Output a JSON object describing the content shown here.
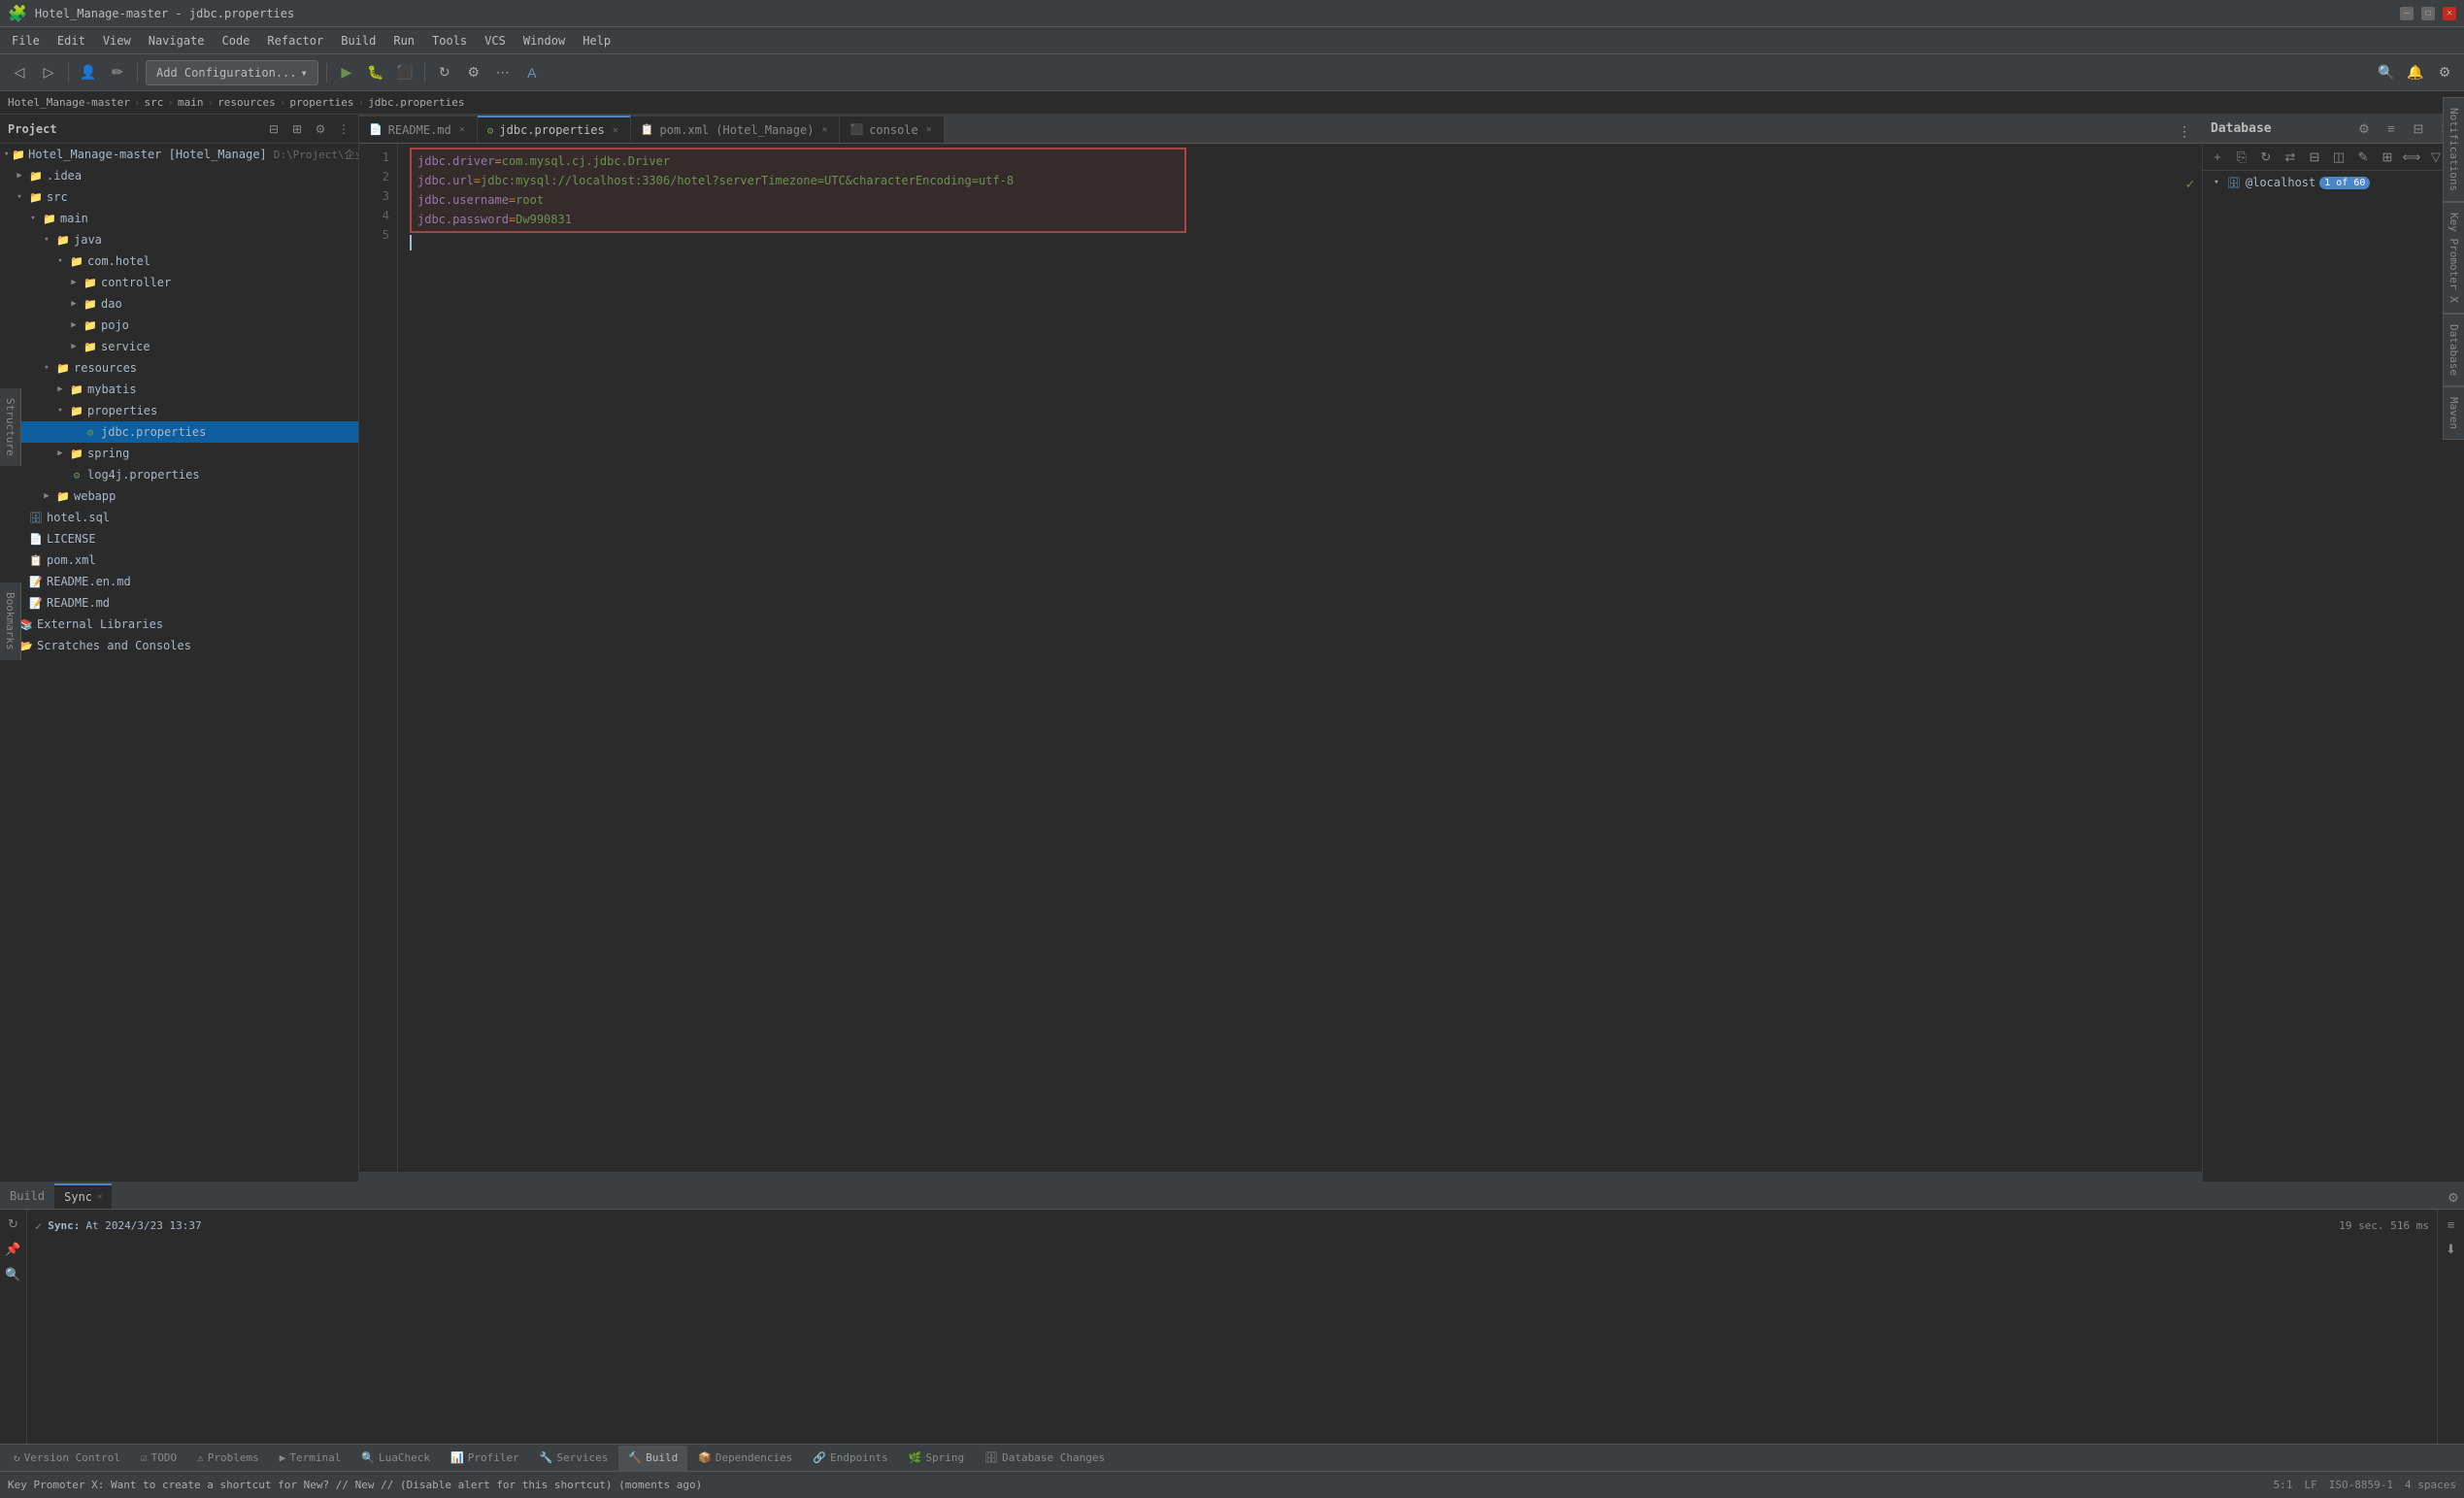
{
  "window": {
    "title": "Hotel_Manage-master - jdbc.properties",
    "controls": [
      "minimize",
      "maximize",
      "close"
    ]
  },
  "menu": {
    "items": [
      "File",
      "Edit",
      "View",
      "Navigate",
      "Code",
      "Refactor",
      "Build",
      "Run",
      "Tools",
      "VCS",
      "Window",
      "Help"
    ]
  },
  "toolbar": {
    "config_label": "Add Configuration...",
    "config_arrow": "▾"
  },
  "breadcrumb": {
    "items": [
      "Hotel_Manage-master",
      "src",
      "main",
      "resources",
      "properties",
      "jdbc.properties"
    ]
  },
  "sidebar": {
    "title": "Project",
    "root": "Hotel_Manage-master [Hotel_Manage]",
    "root_path": "D:\\Project\\企业软著归档\\M",
    "tree": [
      {
        "label": ".idea",
        "indent": 1,
        "type": "folder",
        "expanded": false
      },
      {
        "label": "src",
        "indent": 1,
        "type": "folder",
        "expanded": true
      },
      {
        "label": "main",
        "indent": 2,
        "type": "folder",
        "expanded": true
      },
      {
        "label": "java",
        "indent": 3,
        "type": "folder",
        "expanded": true
      },
      {
        "label": "com.hotel",
        "indent": 4,
        "type": "folder",
        "expanded": true
      },
      {
        "label": "controller",
        "indent": 5,
        "type": "folder",
        "expanded": false
      },
      {
        "label": "dao",
        "indent": 5,
        "type": "folder",
        "expanded": false
      },
      {
        "label": "pojo",
        "indent": 5,
        "type": "folder",
        "expanded": false
      },
      {
        "label": "service",
        "indent": 5,
        "type": "folder",
        "expanded": false
      },
      {
        "label": "resources",
        "indent": 3,
        "type": "folder",
        "expanded": true
      },
      {
        "label": "mybatis",
        "indent": 4,
        "type": "folder",
        "expanded": false
      },
      {
        "label": "properties",
        "indent": 4,
        "type": "folder",
        "expanded": true
      },
      {
        "label": "jdbc.properties",
        "indent": 5,
        "type": "prop",
        "selected": true
      },
      {
        "label": "spring",
        "indent": 4,
        "type": "folder",
        "expanded": false
      },
      {
        "label": "log4j.properties",
        "indent": 4,
        "type": "prop"
      },
      {
        "label": "webapp",
        "indent": 3,
        "type": "folder",
        "expanded": false
      },
      {
        "label": "hotel.sql",
        "indent": 1,
        "type": "sql"
      },
      {
        "label": "LICENSE",
        "indent": 1,
        "type": "file"
      },
      {
        "label": "pom.xml",
        "indent": 1,
        "type": "xml"
      },
      {
        "label": "README.en.md",
        "indent": 1,
        "type": "md"
      },
      {
        "label": "README.md",
        "indent": 1,
        "type": "md"
      },
      {
        "label": "External Libraries",
        "indent": 0,
        "type": "folder",
        "expanded": false
      },
      {
        "label": "Scratches and Consoles",
        "indent": 0,
        "type": "folder",
        "expanded": false
      }
    ]
  },
  "editor": {
    "tabs": [
      {
        "label": "README.md",
        "icon": "📄",
        "active": false,
        "closeable": true
      },
      {
        "label": "jdbc.properties",
        "icon": "🔧",
        "active": true,
        "closeable": true
      },
      {
        "label": "pom.xml (Hotel_Manage)",
        "icon": "📋",
        "active": false,
        "closeable": true
      },
      {
        "label": "console",
        "icon": "⬛",
        "active": false,
        "closeable": true
      }
    ],
    "lines": [
      {
        "num": 1,
        "content": "jdbc.driver=com.mysql.cj.jdbc.Driver"
      },
      {
        "num": 2,
        "content": "jdbc.url=jdbc:mysql://localhost:3306/hotel?serverTimezone=UTC&characterEncoding=utf-8"
      },
      {
        "num": 3,
        "content": "jdbc.username=root"
      },
      {
        "num": 4,
        "content": "jdbc.password=Dw990831"
      },
      {
        "num": 5,
        "content": ""
      }
    ]
  },
  "database_panel": {
    "title": "Database",
    "tree": [
      {
        "label": "@localhost",
        "badge": "1 of 60",
        "type": "db"
      }
    ]
  },
  "build_panel": {
    "tabs": [
      {
        "label": "Build",
        "active": false
      },
      {
        "label": "Sync",
        "active": true,
        "closeable": true
      }
    ],
    "status": {
      "icon": "✓",
      "label": "Sync:",
      "message": "At 2024/3/23 13:37",
      "time": "19 sec. 516 ms"
    }
  },
  "bottom_tabs": [
    {
      "label": "Version Control",
      "icon": "↻",
      "active": false
    },
    {
      "label": "TODO",
      "icon": "☑",
      "active": false
    },
    {
      "label": "Problems",
      "icon": "⚠",
      "active": false
    },
    {
      "label": "Terminal",
      "icon": "▶",
      "active": false
    },
    {
      "label": "LuaCheck",
      "icon": "🔍",
      "active": false
    },
    {
      "label": "Profiler",
      "icon": "📊",
      "active": false
    },
    {
      "label": "Services",
      "icon": "🔧",
      "active": false
    },
    {
      "label": "Build",
      "icon": "🔨",
      "active": true
    },
    {
      "label": "Dependencies",
      "icon": "📦",
      "active": false
    },
    {
      "label": "Endpoints",
      "icon": "🔗",
      "active": false
    },
    {
      "label": "Spring",
      "icon": "🌿",
      "active": false
    },
    {
      "label": "Database Changes",
      "icon": "🗄",
      "active": false
    }
  ],
  "status_bar": {
    "message": "Key Promoter X: Want to create a shortcut for New? // New // (Disable alert for this shortcut) (moments ago)",
    "position": "5:1",
    "lf": "LF",
    "encoding": "ISO-8859-1",
    "indent": "4 spaces"
  },
  "colors": {
    "accent": "#4a86c8",
    "bg_dark": "#2b2b2b",
    "bg_mid": "#3c3f41",
    "selection": "#0d5fa0",
    "highlight_file": "#365880"
  },
  "right_side_labels": [
    "Notifications",
    "Key Promoter X",
    "Database",
    "Maven"
  ]
}
